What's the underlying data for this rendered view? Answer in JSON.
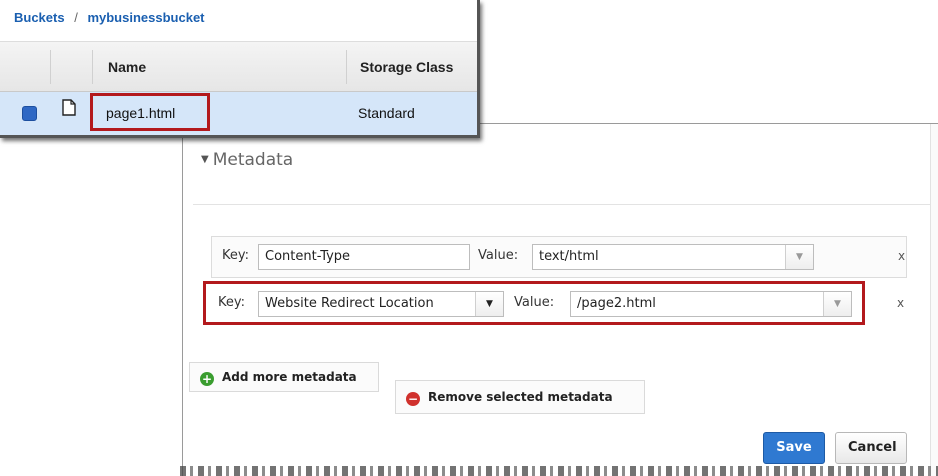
{
  "breadcrumb": {
    "root": "Buckets",
    "separator": "/",
    "current": "mybusinessbucket"
  },
  "table": {
    "columns": [
      "Name",
      "Storage Class"
    ],
    "rows": [
      {
        "selected": true,
        "icon": "file-icon",
        "name": "page1.html",
        "storage_class": "Standard"
      }
    ]
  },
  "metadata": {
    "section_title": "Metadata",
    "rows": [
      {
        "key_label": "Key:",
        "key": "Content-Type",
        "value_label": "Value:",
        "value": "text/html",
        "remove": "x"
      },
      {
        "key_label": "Key:",
        "key": "Website Redirect Location",
        "value_label": "Value:",
        "value": "/page2.html",
        "remove": "x"
      }
    ],
    "add_label": "Add more metadata",
    "remove_label": "Remove selected metadata"
  },
  "buttons": {
    "save": "Save",
    "cancel": "Cancel"
  },
  "colors": {
    "highlight": "#b3191d",
    "accent": "#2f79d1",
    "selected_row": "#d5e6f9",
    "add": "#3a9d2f",
    "remove": "#d0312d"
  }
}
